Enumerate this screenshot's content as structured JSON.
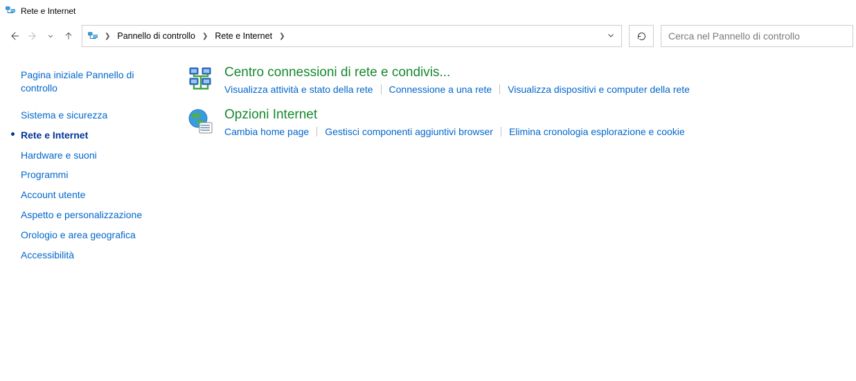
{
  "window": {
    "title": "Rete e Internet"
  },
  "breadcrumb": {
    "segments": [
      "Pannello di controllo",
      "Rete e Internet"
    ]
  },
  "search": {
    "placeholder": "Cerca nel Pannello di controllo"
  },
  "sidebar": {
    "home": "Pagina iniziale Pannello di controllo",
    "items": [
      {
        "label": "Sistema e sicurezza",
        "current": false
      },
      {
        "label": "Rete e Internet",
        "current": true
      },
      {
        "label": "Hardware e suoni",
        "current": false
      },
      {
        "label": "Programmi",
        "current": false
      },
      {
        "label": "Account utente",
        "current": false
      },
      {
        "label": "Aspetto e personalizzazione",
        "current": false
      },
      {
        "label": "Orologio e area geografica",
        "current": false
      },
      {
        "label": "Accessibilità",
        "current": false
      }
    ]
  },
  "main": {
    "categories": [
      {
        "icon": "network-sharing-icon",
        "title": "Centro connessioni di rete e condivis...",
        "tasks": [
          "Visualizza attività e stato della rete",
          "Connessione a una rete",
          "Visualizza dispositivi e computer della rete"
        ]
      },
      {
        "icon": "internet-options-icon",
        "title": "Opzioni Internet",
        "tasks": [
          "Cambia home page",
          "Gestisci componenti aggiuntivi browser",
          "Elimina cronologia esplorazione e cookie"
        ]
      }
    ]
  }
}
